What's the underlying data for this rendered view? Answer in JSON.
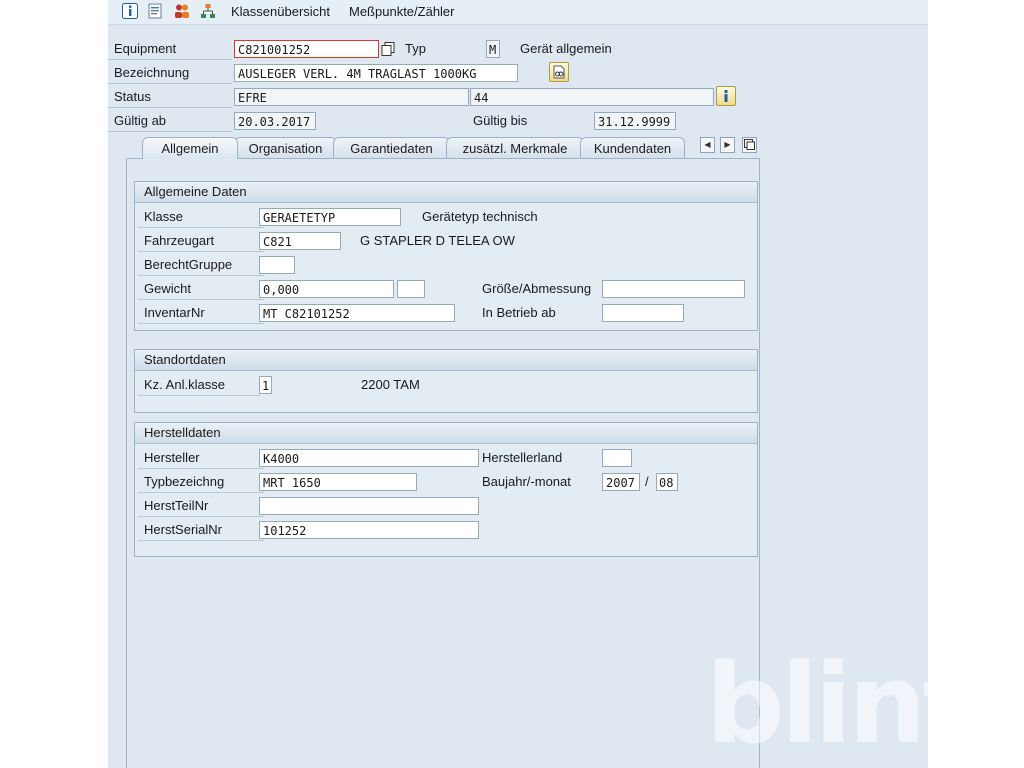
{
  "toolbar": {
    "links": [
      "Klassenübersicht",
      "Meßpunkte/Zähler"
    ]
  },
  "header": {
    "equipment_label": "Equipment",
    "equipment_value": "C821001252",
    "typ_label": "Typ",
    "typ_value": "M",
    "typ_desc": "Gerät allgemein",
    "bezeichnung_label": "Bezeichnung",
    "bezeichnung_value": "AUSLEGER VERL. 4M TRAGLAST 1000KG",
    "status_label": "Status",
    "status_value": "EFRE",
    "status_value2": "44",
    "gueltig_ab_label": "Gültig ab",
    "gueltig_ab_value": "20.03.2017",
    "gueltig_bis_label": "Gültig bis",
    "gueltig_bis_value": "31.12.9999"
  },
  "tabs": [
    "Allgemein",
    "Organisation",
    "Garantiedaten",
    "zusätzl. Merkmale",
    "Kundendaten"
  ],
  "active_tab": "Allgemein",
  "allgemeine_daten": {
    "title": "Allgemeine Daten",
    "klasse_label": "Klasse",
    "klasse_value": "GERAETETYP",
    "klasse_desc": "Gerätetyp technisch",
    "fahrzeugart_label": "Fahrzeugart",
    "fahrzeugart_value": "C821",
    "fahrzeugart_desc": "G STAPLER D TELEA OW",
    "berechtgruppe_label": "BerechtGruppe",
    "berechtgruppe_value": "",
    "gewicht_label": "Gewicht",
    "gewicht_value": "0,000",
    "gewicht_unit": "",
    "groesse_label": "Größe/Abmessung",
    "groesse_value": "",
    "inventarnr_label": "InventarNr",
    "inventarnr_value": "MT C82101252",
    "inbetrieb_label": "In Betrieb ab",
    "inbetrieb_value": ""
  },
  "standortdaten": {
    "title": "Standortdaten",
    "anlklasse_label": "Kz. Anl.klasse",
    "anlklasse_value": "1",
    "anlklasse_desc": "2200 TAM"
  },
  "herstelldaten": {
    "title": "Herstelldaten",
    "hersteller_label": "Hersteller",
    "hersteller_value": "K4000",
    "herstellerland_label": "Herstellerland",
    "herstellerland_value": "",
    "typbez_label": "Typbezeichng",
    "typbez_value": "MRT 1650",
    "baujahr_label": "Baujahr/-monat",
    "baujahr_year": "2007",
    "baujahr_sep": "/",
    "baujahr_month": "08",
    "herstteilnr_label": "HerstTeilNr",
    "herstteilnr_value": "",
    "herstserialnr_label": "HerstSerialNr",
    "herstserialnr_value": "101252"
  },
  "watermark": "blint",
  "colors": {
    "app_bg": "#dfe8f1",
    "field_border": "#95a9bd",
    "icon_blue": "#1f5fa8",
    "focus_red": "#d23b2a"
  }
}
